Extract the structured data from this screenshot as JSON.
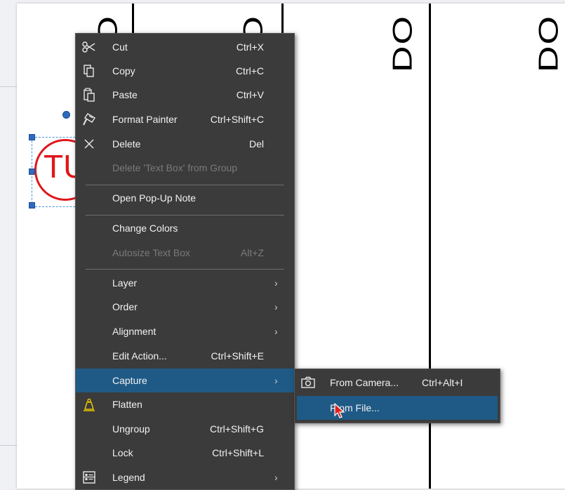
{
  "document": {
    "column_labels": [
      "DO",
      "DO",
      "DO",
      "DO"
    ],
    "stamp_text": "TU"
  },
  "context_menu": {
    "items": [
      {
        "label": "Cut",
        "shortcut": "Ctrl+X",
        "icon": "scissors-icon",
        "enabled": true
      },
      {
        "label": "Copy",
        "shortcut": "Ctrl+C",
        "icon": "copy-icon",
        "enabled": true
      },
      {
        "label": "Paste",
        "shortcut": "Ctrl+V",
        "icon": "paste-icon",
        "enabled": true
      },
      {
        "label": "Format Painter",
        "shortcut": "Ctrl+Shift+C",
        "icon": "format-painter-icon",
        "enabled": true
      },
      {
        "label": "Delete",
        "shortcut": "Del",
        "icon": "delete-x-icon",
        "enabled": true
      },
      {
        "label": "Delete 'Text Box' from Group",
        "shortcut": "",
        "icon": "",
        "enabled": false
      },
      {
        "label": "Open Pop-Up Note",
        "shortcut": "",
        "icon": "",
        "enabled": true
      },
      {
        "label": "Change Colors",
        "shortcut": "",
        "icon": "",
        "enabled": true
      },
      {
        "label": "Autosize Text Box",
        "shortcut": "Alt+Z",
        "icon": "",
        "enabled": false
      },
      {
        "label": "Layer",
        "shortcut": "",
        "icon": "",
        "enabled": true,
        "submenu": true
      },
      {
        "label": "Order",
        "shortcut": "",
        "icon": "",
        "enabled": true,
        "submenu": true
      },
      {
        "label": "Alignment",
        "shortcut": "",
        "icon": "",
        "enabled": true,
        "submenu": true
      },
      {
        "label": "Edit Action...",
        "shortcut": "Ctrl+Shift+E",
        "icon": "",
        "enabled": true
      },
      {
        "label": "Capture",
        "shortcut": "",
        "icon": "",
        "enabled": true,
        "submenu": true,
        "highlighted": true
      },
      {
        "label": "Flatten",
        "shortcut": "",
        "icon": "flatten-weight-icon",
        "enabled": true
      },
      {
        "label": "Ungroup",
        "shortcut": "Ctrl+Shift+G",
        "icon": "",
        "enabled": true
      },
      {
        "label": "Lock",
        "shortcut": "Ctrl+Shift+L",
        "icon": "",
        "enabled": true
      },
      {
        "label": "Legend",
        "shortcut": "",
        "icon": "legend-icon",
        "enabled": true,
        "submenu": true
      }
    ],
    "submenu_arrow": "›"
  },
  "capture_submenu": {
    "items": [
      {
        "label": "From Camera...",
        "shortcut": "Ctrl+Alt+I",
        "icon": "camera-icon"
      },
      {
        "label": "From File...",
        "shortcut": "",
        "icon": "",
        "highlighted": true
      }
    ]
  },
  "colors": {
    "menu_bg": "#3b3b3b",
    "highlight": "#1f5a86",
    "stamp_red": "#e0161b",
    "selection_blue": "#2e6bbf"
  }
}
